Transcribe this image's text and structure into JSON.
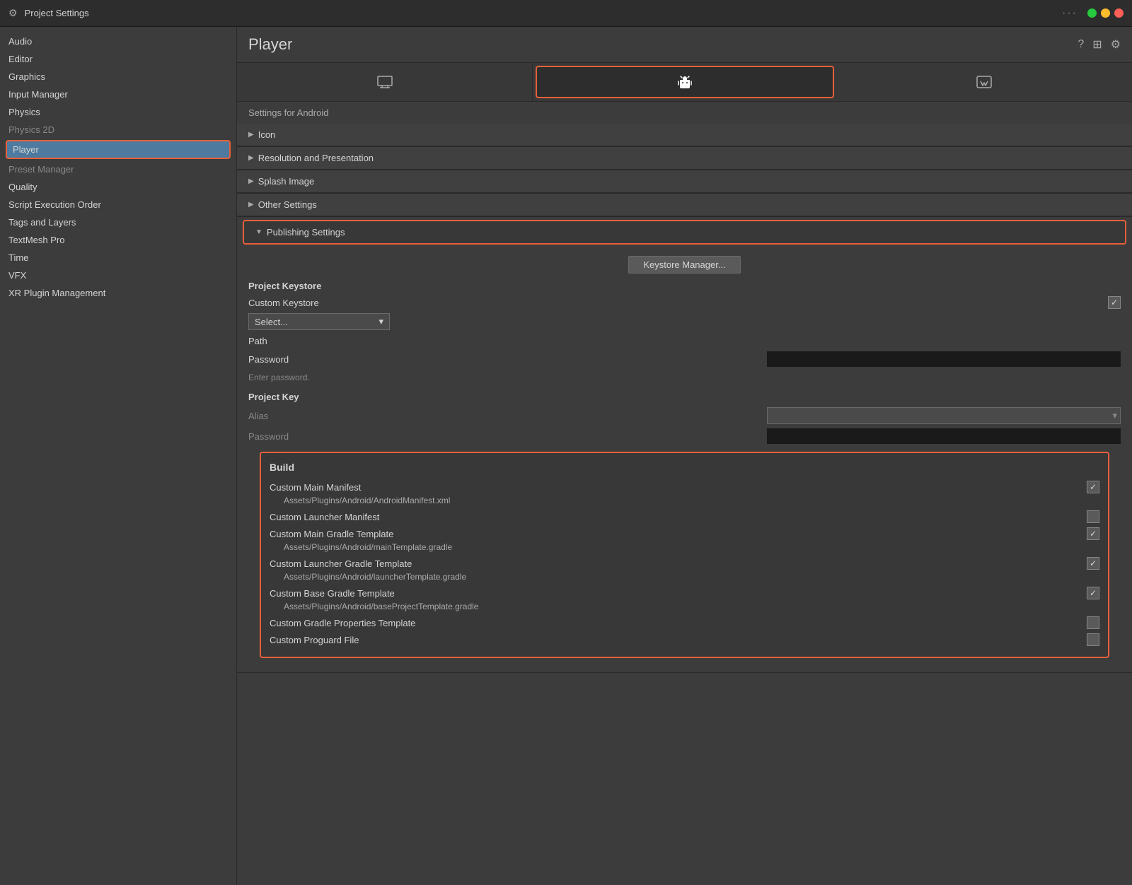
{
  "titlebar": {
    "title": "Project Settings",
    "icon": "⚙"
  },
  "sidebar": {
    "items": [
      {
        "label": "Audio",
        "active": false
      },
      {
        "label": "Editor",
        "active": false
      },
      {
        "label": "Graphics",
        "active": false
      },
      {
        "label": "Input Manager",
        "active": false
      },
      {
        "label": "Physics",
        "active": false
      },
      {
        "label": "Physics 2D",
        "active": false,
        "muted": true
      },
      {
        "label": "Player",
        "active": true
      },
      {
        "label": "Preset Manager",
        "active": false,
        "muted": true
      },
      {
        "label": "Quality",
        "active": false
      },
      {
        "label": "Script Execution Order",
        "active": false
      },
      {
        "label": "Tags and Layers",
        "active": false
      },
      {
        "label": "TextMesh Pro",
        "active": false
      },
      {
        "label": "Time",
        "active": false
      },
      {
        "label": "VFX",
        "active": false
      },
      {
        "label": "XR Plugin Management",
        "active": false
      }
    ]
  },
  "content": {
    "title": "Player",
    "settings_label": "Settings for Android",
    "tabs": [
      {
        "label": "🖥",
        "active": false
      },
      {
        "label": "🤖",
        "active": true
      },
      {
        "label": "🌐",
        "active": false
      }
    ],
    "sections": [
      {
        "label": "Icon",
        "expanded": false
      },
      {
        "label": "Resolution and Presentation",
        "expanded": false
      },
      {
        "label": "Splash Image",
        "expanded": false
      },
      {
        "label": "Other Settings",
        "expanded": false
      },
      {
        "label": "Publishing Settings",
        "expanded": true
      }
    ],
    "publishing": {
      "keystore_btn": "Keystore Manager...",
      "project_keystore_title": "Project Keystore",
      "custom_keystore_label": "Custom Keystore",
      "select_label": "Select...",
      "path_label": "Path",
      "password_label": "Password",
      "enter_password_hint": "Enter password.",
      "project_key_title": "Project Key",
      "alias_label": "Alias",
      "key_password_label": "Password"
    },
    "build": {
      "title": "Build",
      "rows": [
        {
          "label": "Custom Main Manifest",
          "checked": true,
          "path": "Assets/Plugins/Android/AndroidManifest.xml"
        },
        {
          "label": "Custom Launcher Manifest",
          "checked": false,
          "path": null
        },
        {
          "label": "Custom Main Gradle Template",
          "checked": true,
          "path": "Assets/Plugins/Android/mainTemplate.gradle"
        },
        {
          "label": "Custom Launcher Gradle Template",
          "checked": true,
          "path": "Assets/Plugins/Android/launcherTemplate.gradle"
        },
        {
          "label": "Custom Base Gradle Template",
          "checked": true,
          "path": "Assets/Plugins/Android/baseProjectTemplate.gradle"
        },
        {
          "label": "Custom Gradle Properties Template",
          "checked": false,
          "path": null
        },
        {
          "label": "Custom Proguard File",
          "checked": false,
          "path": null
        }
      ]
    }
  },
  "icons": {
    "help": "?",
    "layout": "⊞",
    "settings": "⚙",
    "arrow_right": "▶",
    "arrow_down": "▼",
    "chevron_down": "▾",
    "check": "✓",
    "search": "🔍"
  }
}
